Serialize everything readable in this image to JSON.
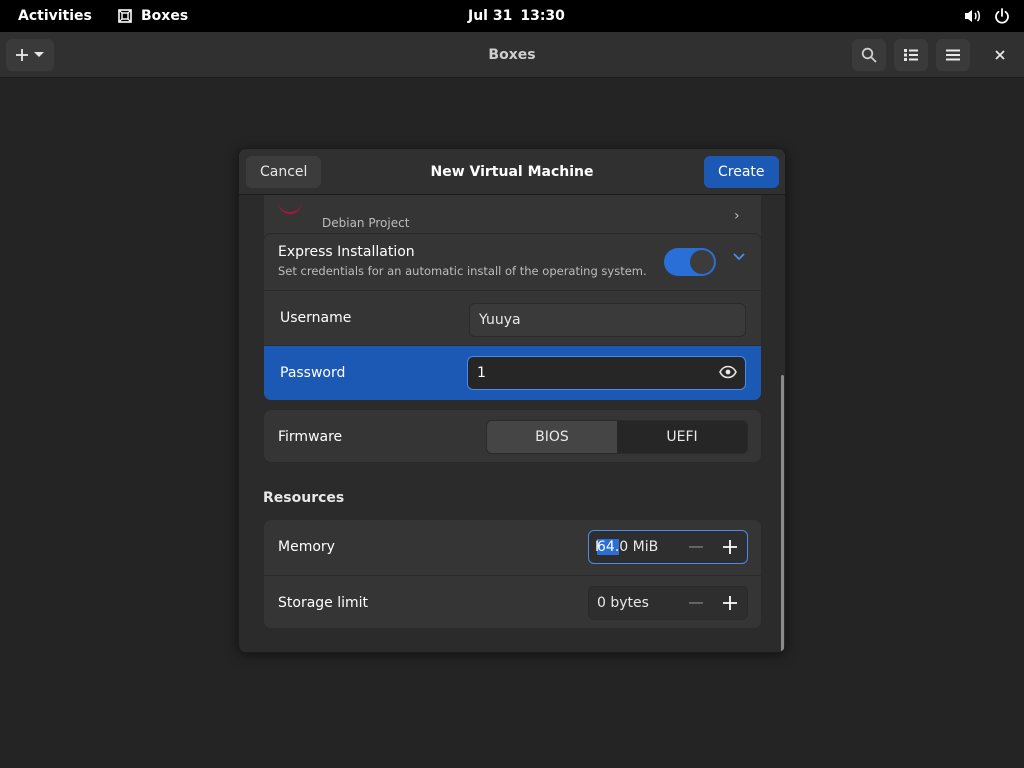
{
  "topbar": {
    "activities": "Activities",
    "app_name": "Boxes",
    "date": "Jul 31",
    "time": "13:30",
    "icons": [
      "boxes-app-icon",
      "volume-icon",
      "power-icon"
    ]
  },
  "headerbar": {
    "title": "Boxes",
    "icons": [
      "plus-icon",
      "chevron-down-icon",
      "search-icon",
      "list-view-icon",
      "hamburger-menu-icon",
      "close-icon"
    ]
  },
  "dialog": {
    "title": "New Virtual Machine",
    "cancel_label": "Cancel",
    "create_label": "Create",
    "os": {
      "subtitle": "Debian Project"
    },
    "express": {
      "title": "Express Installation",
      "subtitle": "Set credentials for an automatic install of the operating system.",
      "enabled": true,
      "username_label": "Username",
      "username_value": "Yuuya",
      "password_label": "Password",
      "password_value": "1"
    },
    "firmware": {
      "label": "Firmware",
      "options": [
        "BIOS",
        "UEFI"
      ],
      "selected": "UEFI"
    },
    "resources": {
      "heading": "Resources",
      "memory_label": "Memory",
      "memory_value_selected": "64.",
      "memory_value_rest": "0 MiB",
      "storage_label": "Storage limit",
      "storage_value": "0 bytes"
    }
  },
  "colors": {
    "accent": "#1c59b5",
    "toggle_on": "#2a6fd8",
    "background": "#242424"
  }
}
